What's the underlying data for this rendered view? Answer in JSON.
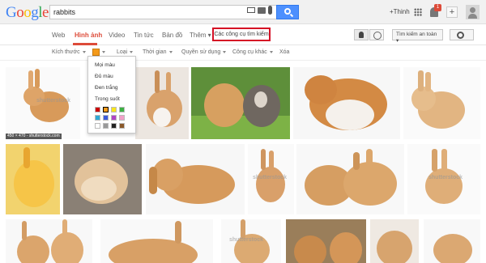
{
  "header": {
    "logo": {
      "letters": [
        "G",
        "o",
        "o",
        "g",
        "l",
        "e"
      ],
      "colors": [
        "#4285f4",
        "#ea4335",
        "#fbbc05",
        "#4285f4",
        "#34a853",
        "#ea4335"
      ]
    },
    "search": {
      "value": "rabbits"
    },
    "user_link": "+Thinh",
    "notification_count": "1",
    "share_symbol": "+"
  },
  "tabs": {
    "items": [
      "Web",
      "Hình ảnh",
      "Video",
      "Tin tức",
      "Bản đồ",
      "Thêm ▾"
    ],
    "active_index": 1,
    "search_tools": "Các công cụ tìm kiếm",
    "safe_search": "Tìm kiếm an toàn ▾"
  },
  "filters": {
    "size": "Kích thước",
    "type": "Loại",
    "time": "Thời gian",
    "usage_rights": "Quyền sử dụng",
    "more_tools": "Công cụ khác",
    "clear": "Xóa",
    "selected_color": "#f49a1a"
  },
  "color_dropdown": {
    "items": [
      "Mọi màu",
      "Đủ màu",
      "Đen trắng",
      "Trong suốt"
    ],
    "swatches": [
      "#cc0000",
      "#f49a1a",
      "#f7e51c",
      "#3cb043",
      "#2fa9d6",
      "#3b5bdb",
      "#b044c4",
      "#f2a0c8",
      "#ffffff",
      "#999999",
      "#222222",
      "#8b5a2b"
    ]
  },
  "results": {
    "caption_1": "450 × 470 - shutterstock.com",
    "watermark": "shutterstock"
  },
  "colors": {
    "accent": "#dd4b39",
    "search_button": "#4d90fe",
    "tools_highlight": "#d50f25"
  }
}
